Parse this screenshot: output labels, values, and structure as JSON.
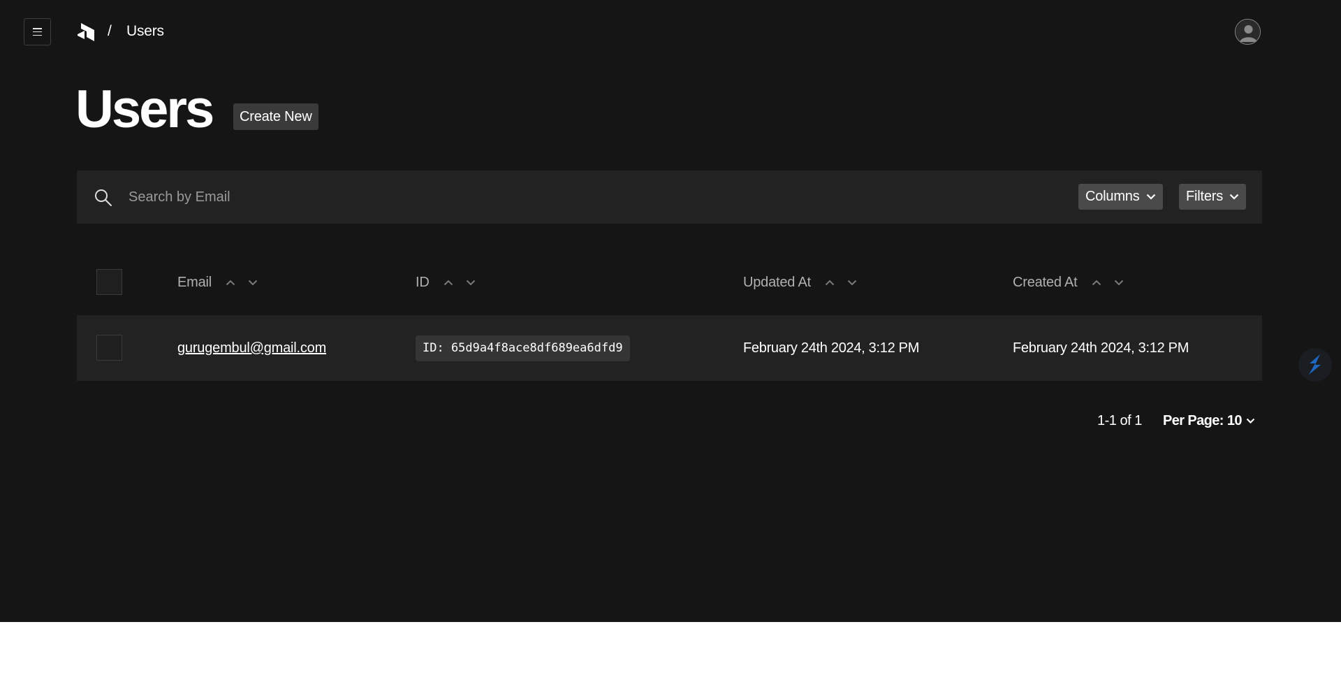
{
  "header": {
    "menu_icon": "menu-icon",
    "logo_icon": "payload-logo-icon",
    "breadcrumb_separator": "/",
    "breadcrumb_current": "Users",
    "avatar_icon": "user-avatar-icon"
  },
  "page": {
    "title": "Users",
    "create_button": "Create New"
  },
  "search": {
    "placeholder": "Search by Email",
    "value": "",
    "icon": "search-icon",
    "columns_button": "Columns",
    "filters_button": "Filters"
  },
  "table": {
    "columns": [
      "Email",
      "ID",
      "Updated At",
      "Created At"
    ],
    "rows": [
      {
        "email": "gurugembul@gmail.com",
        "id": "ID: 65d9a4f8ace8df689ea6dfd9",
        "updated_at": "February 24th 2024, 3:12 PM",
        "created_at": "February 24th 2024, 3:12 PM"
      }
    ]
  },
  "pagination": {
    "range": "1-1 of 1",
    "per_page": "Per Page: 10"
  },
  "colors": {
    "background": "#151515",
    "surface": "#222222",
    "button": "#4a4a4a",
    "accent_fab": "#1f6fd1"
  }
}
